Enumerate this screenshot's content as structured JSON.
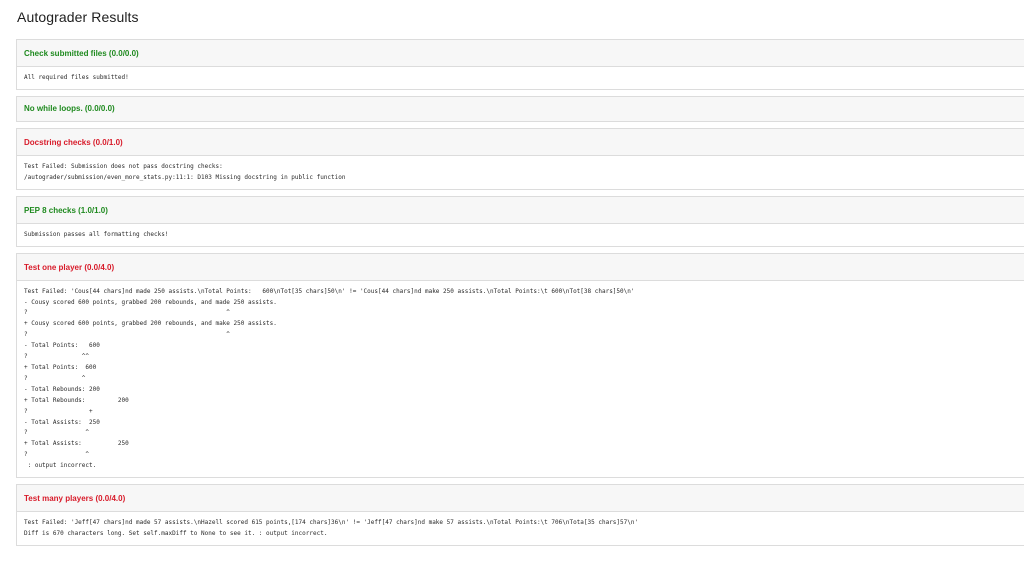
{
  "page": {
    "title": "Autograder Results"
  },
  "tests": [
    {
      "title": "Check submitted files (0.0/0.0)",
      "status": "pass",
      "output": "All required files submitted!"
    },
    {
      "title": "No while loops. (0.0/0.0)",
      "status": "pass",
      "output": null
    },
    {
      "title": "Docstring checks (0.0/1.0)",
      "status": "fail",
      "output": "Test Failed: Submission does not pass docstring checks:\n/autograder/submission/even_more_stats.py:11:1: D103 Missing docstring in public function"
    },
    {
      "title": "PEP 8 checks (1.0/1.0)",
      "status": "pass",
      "output": "Submission passes all formatting checks!"
    },
    {
      "title": "Test one player (0.0/4.0)",
      "status": "fail",
      "output": "Test Failed: 'Cous[44 chars]nd made 250 assists.\\nTotal Points:   600\\nTot[35 chars]50\\n' != 'Cous[44 chars]nd make 250 assists.\\nTotal Points:\\t 600\\nTot[38 chars]50\\n'\n- Cousy scored 600 points, grabbed 200 rebounds, and made 250 assists.\n?                                                       ^\n+ Cousy scored 600 points, grabbed 200 rebounds, and make 250 assists.\n?                                                       ^\n- Total Points:   600\n?               ^^\n+ Total Points:  600\n?               ^\n- Total Rebounds: 200\n+ Total Rebounds:         200\n?                 +\n- Total Assists:  250\n?                ^\n+ Total Assists:          250\n?                ^\n : output incorrect."
    },
    {
      "title": "Test many players (0.0/4.0)",
      "status": "fail",
      "output": "Test Failed: 'Jeff[47 chars]nd made 57 assists.\\nHazell scored 615 points,[174 chars]36\\n' != 'Jeff[47 chars]nd make 57 assists.\\nTotal Points:\\t 706\\nTota[35 chars]57\\n'\nDiff is 670 characters long. Set self.maxDiff to None to see it. : output incorrect."
    }
  ]
}
